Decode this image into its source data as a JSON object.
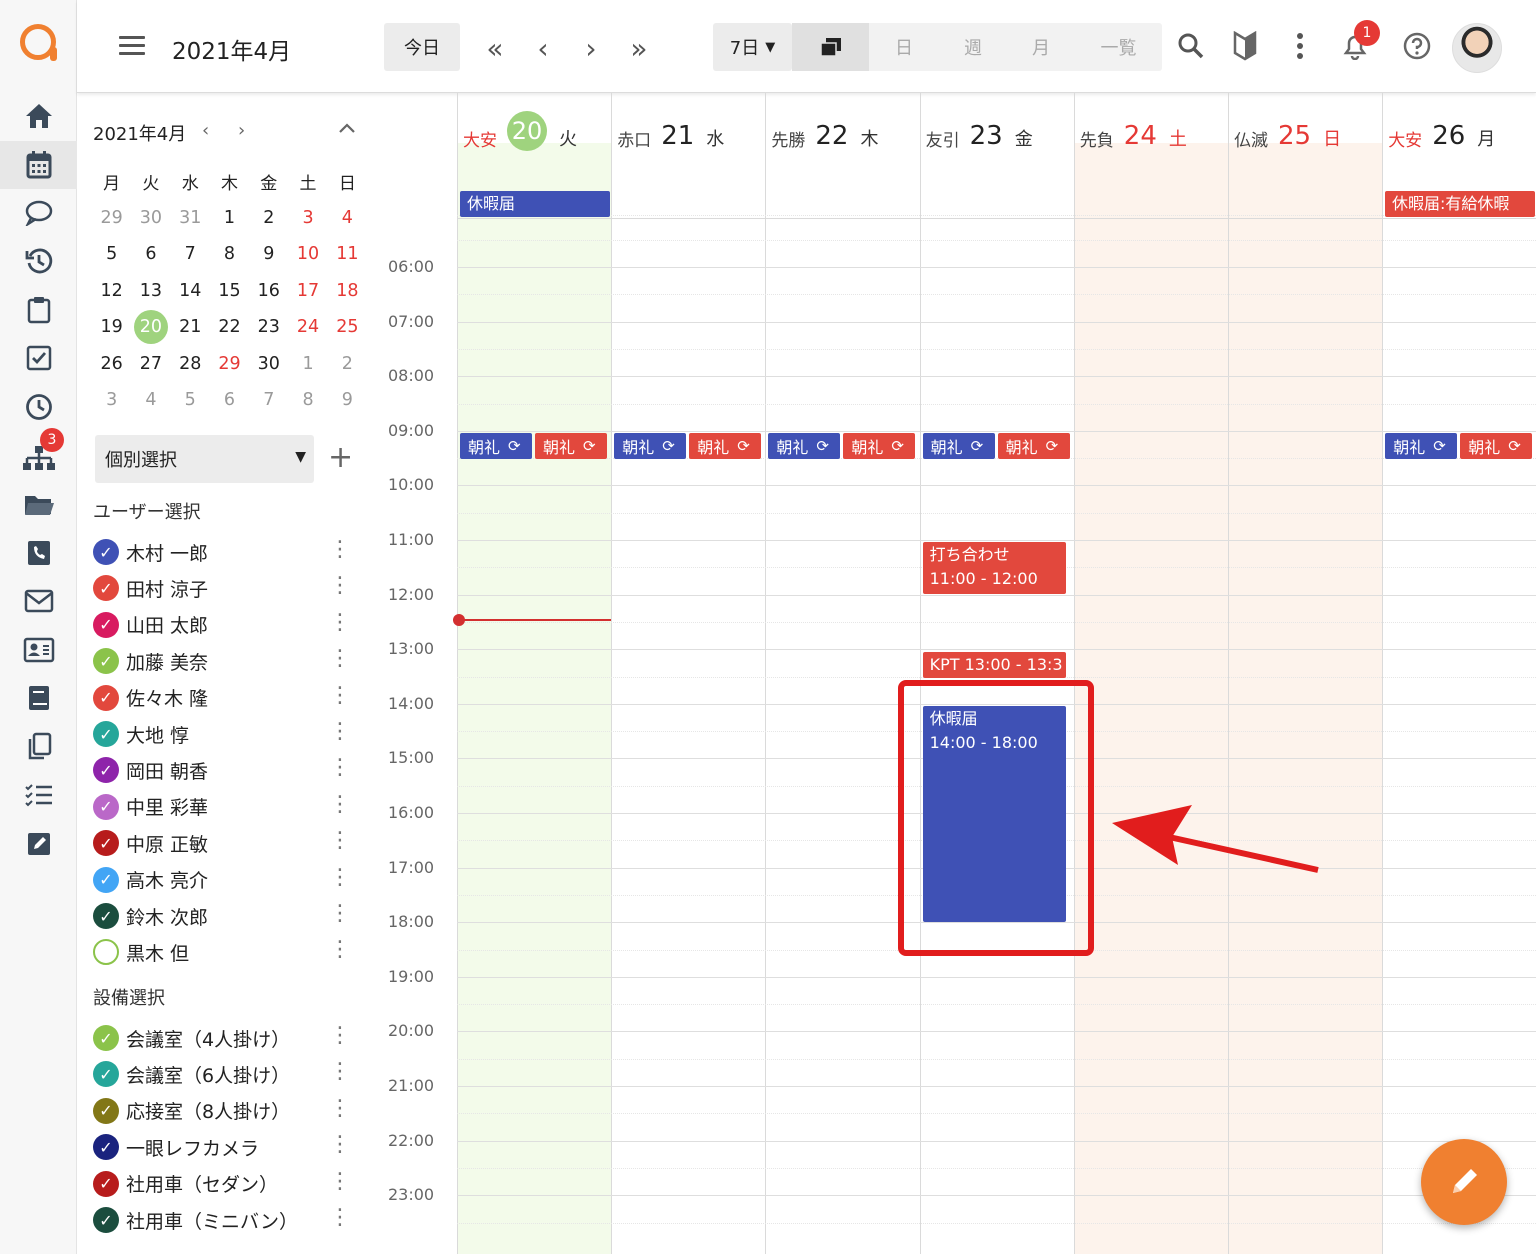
{
  "header": {
    "title": "2021年4月",
    "today_label": "今日",
    "range_value": "7日",
    "views": [
      "",
      "日",
      "週",
      "月",
      "一覧"
    ],
    "notification_count": "1"
  },
  "rail": {
    "badge": "3",
    "icons": [
      "home-icon",
      "calendar-icon",
      "chat-icon",
      "history-icon",
      "clipboard-icon",
      "task-check-icon",
      "clock-icon",
      "org-chart-icon",
      "folder-icon",
      "phone-book-icon",
      "mail-icon",
      "contact-card-icon",
      "book-icon",
      "copy-icon",
      "checklist-icon",
      "edit-note-icon"
    ]
  },
  "mini_calendar": {
    "title": "2021年4月",
    "weekdays": [
      "月",
      "火",
      "水",
      "木",
      "金",
      "土",
      "日"
    ],
    "weeks": [
      [
        "29",
        "30",
        "31",
        "1",
        "2",
        "3",
        "4"
      ],
      [
        "5",
        "6",
        "7",
        "8",
        "9",
        "10",
        "11"
      ],
      [
        "12",
        "13",
        "14",
        "15",
        "16",
        "17",
        "18"
      ],
      [
        "19",
        "20",
        "21",
        "22",
        "23",
        "24",
        "25"
      ],
      [
        "26",
        "27",
        "28",
        "29",
        "30",
        "1",
        "2"
      ],
      [
        "3",
        "4",
        "5",
        "6",
        "7",
        "8",
        "9"
      ]
    ]
  },
  "filter": {
    "select_value": "個別選択",
    "user_section": "ユーザー選択",
    "facility_section": "設備選択",
    "users": [
      {
        "name": "木村 一郎",
        "color": "#3f51b5"
      },
      {
        "name": "田村 涼子",
        "color": "#e2483d"
      },
      {
        "name": "山田 太郎",
        "color": "#d81b60"
      },
      {
        "name": "加藤 美奈",
        "color": "#8bc34a"
      },
      {
        "name": "佐々木 隆",
        "color": "#e2483d"
      },
      {
        "name": "大地 惇",
        "color": "#26a69a"
      },
      {
        "name": "岡田 朝香",
        "color": "#8e24aa"
      },
      {
        "name": "中里 彩華",
        "color": "#ba68c8"
      },
      {
        "name": "中原 正敏",
        "color": "#b71c1c"
      },
      {
        "name": "高木 亮介",
        "color": "#42a5f5"
      },
      {
        "name": "鈴木 次郎",
        "color": "#1b4d3e"
      },
      {
        "name": "黒木 但",
        "color": "#8bc34a"
      }
    ],
    "facilities": [
      {
        "name": "会議室（4人掛け）",
        "color": "#8bc34a"
      },
      {
        "name": "会議室（6人掛け）",
        "color": "#26a69a"
      },
      {
        "name": "応接室（8人掛け）",
        "color": "#827717"
      },
      {
        "name": "一眼レフカメラ",
        "color": "#1a237e"
      },
      {
        "name": "社用車（セダン）",
        "color": "#b71c1c"
      },
      {
        "name": "社用車（ミニバン）",
        "color": "#1b4d3e"
      }
    ]
  },
  "calendar": {
    "days": [
      {
        "rokuyo": "大安",
        "num": "20",
        "name": "火"
      },
      {
        "rokuyo": "赤口",
        "num": "21",
        "name": "水"
      },
      {
        "rokuyo": "先勝",
        "num": "22",
        "name": "木"
      },
      {
        "rokuyo": "友引",
        "num": "23",
        "name": "金"
      },
      {
        "rokuyo": "先負",
        "num": "24",
        "name": "土"
      },
      {
        "rokuyo": "仏滅",
        "num": "25",
        "name": "日"
      },
      {
        "rokuyo": "大安",
        "num": "26",
        "name": "月"
      }
    ],
    "times": [
      "06:00",
      "07:00",
      "08:00",
      "09:00",
      "10:00",
      "11:00",
      "12:00",
      "13:00",
      "14:00",
      "15:00",
      "16:00",
      "17:00",
      "18:00",
      "19:00",
      "20:00",
      "21:00",
      "22:00",
      "23:00"
    ],
    "allday_events": {
      "tue": "休暇届",
      "mon": "休暇届:有給休暇"
    },
    "chip_label": "朝礼",
    "events": {
      "meeting_title": "打ち合わせ",
      "meeting_time": "11:00 - 12:00",
      "kpt": "KPT  13:00 - 13:3",
      "leave_title": "休暇届",
      "leave_time": "14:00 - 18:00"
    }
  }
}
